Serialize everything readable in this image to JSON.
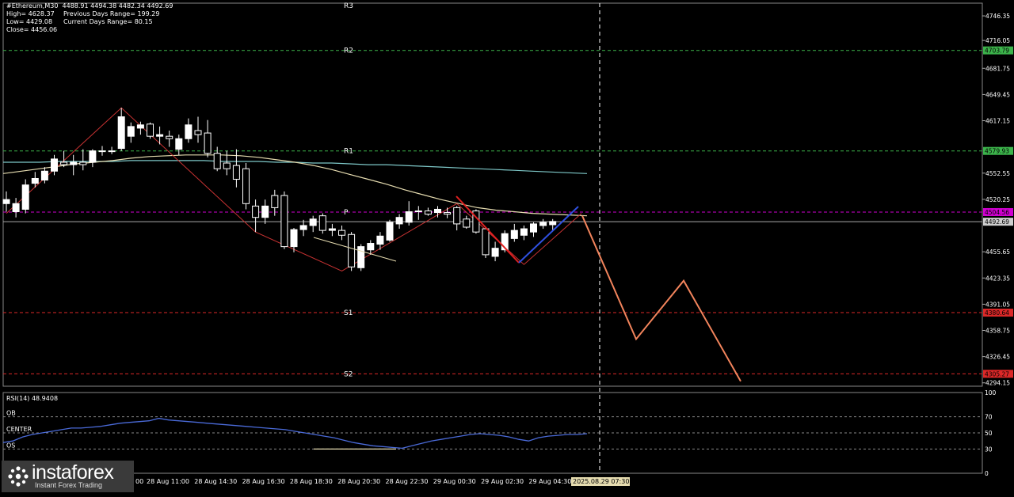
{
  "header": {
    "title": "#Ethereum,M30",
    "ohlc": "4488.91 4494.38 4482.34 4492.69",
    "high": "High= 4628.37",
    "prev_range": "Previous Days Range= 199.29",
    "low": "Low= 4429.08",
    "curr_range": "Current Days Range= 80.15",
    "close": "Close= 4456.06"
  },
  "watermark": {
    "brand": "instaforex",
    "tagline": "Instant Forex Trading"
  },
  "colors": {
    "background": "#000000",
    "bull_candle": "#ffffff",
    "bear_candle": "#000000",
    "ma_fast": "#c8e6a0",
    "ma_mid": "#e6dcb0",
    "ma_slow": "#7ec8c8",
    "zigzag": "#c83232",
    "forecast": "#f2845c",
    "rsi": "#4a6ad8",
    "pivot_green": "#3cb44b",
    "pivot_red": "#dc2828",
    "pivot_magenta": "#d000d0"
  },
  "price_axis": {
    "ticks": [
      "4746.35",
      "4716.05",
      "4681.75",
      "4649.45",
      "4617.15",
      "4552.55",
      "4520.25",
      "4455.65",
      "4423.35",
      "4391.05",
      "4358.75",
      "4326.45",
      "4294.15"
    ],
    "min": 4290,
    "max": 4762
  },
  "levels": [
    {
      "name": "R3",
      "label": "R3",
      "price": 4762,
      "box": "",
      "color": "#ffffff"
    },
    {
      "name": "R2",
      "label": "R2",
      "price": 4703.79,
      "box": "4703.79",
      "color": "#3cb44b"
    },
    {
      "name": "R1",
      "label": "R1",
      "price": 4579.93,
      "box": "4579.93",
      "color": "#3cb44b"
    },
    {
      "name": "P",
      "label": "P",
      "price": 4504.56,
      "box": "4504.56",
      "color": "#d000d0"
    },
    {
      "name": "S1",
      "label": "S1",
      "price": 4380.64,
      "box": "4380.64",
      "color": "#dc2828"
    },
    {
      "name": "S2",
      "label": "S2",
      "price": 4305.27,
      "box": "4305.27",
      "color": "#dc2828"
    }
  ],
  "current_price": {
    "price": 4492.69,
    "box": "4492.69"
  },
  "time_axis": {
    "labels": [
      "28 Aug 11:00",
      "28 Aug 14:30",
      "28 Aug 16:30",
      "28 Aug 18:30",
      "28 Aug 20:30",
      "28 Aug 22:30",
      "29 Aug 00:30",
      "29 Aug 02:30",
      "29 Aug 04:30"
    ],
    "highlight": "2025.08.29 07:30",
    "partial_first": "00"
  },
  "chart_data": {
    "type": "candlestick",
    "instrument": "#Ethereum",
    "timeframe": "M30",
    "candles": [
      {
        "o": 4515,
        "h": 4530,
        "l": 4505,
        "c": 4520
      },
      {
        "o": 4505,
        "h": 4522,
        "l": 4498,
        "c": 4515
      },
      {
        "o": 4508,
        "h": 4545,
        "l": 4503,
        "c": 4538
      },
      {
        "o": 4540,
        "h": 4554,
        "l": 4535,
        "c": 4546
      },
      {
        "o": 4544,
        "h": 4560,
        "l": 4540,
        "c": 4555
      },
      {
        "o": 4555,
        "h": 4575,
        "l": 4550,
        "c": 4570
      },
      {
        "o": 4566,
        "h": 4580,
        "l": 4560,
        "c": 4563
      },
      {
        "o": 4563,
        "h": 4575,
        "l": 4550,
        "c": 4566
      },
      {
        "o": 4566,
        "h": 4582,
        "l": 4556,
        "c": 4563
      },
      {
        "o": 4566,
        "h": 4582,
        "l": 4560,
        "c": 4580
      },
      {
        "o": 4580,
        "h": 4586,
        "l": 4574,
        "c": 4580
      },
      {
        "o": 4580,
        "h": 4585,
        "l": 4576,
        "c": 4580
      },
      {
        "o": 4583,
        "h": 4633,
        "l": 4580,
        "c": 4622
      },
      {
        "o": 4598,
        "h": 4615,
        "l": 4590,
        "c": 4610
      },
      {
        "o": 4608,
        "h": 4616,
        "l": 4600,
        "c": 4612
      },
      {
        "o": 4613,
        "h": 4615,
        "l": 4595,
        "c": 4598
      },
      {
        "o": 4598,
        "h": 4610,
        "l": 4588,
        "c": 4600
      },
      {
        "o": 4598,
        "h": 4605,
        "l": 4585,
        "c": 4595
      },
      {
        "o": 4582,
        "h": 4600,
        "l": 4575,
        "c": 4595
      },
      {
        "o": 4595,
        "h": 4620,
        "l": 4590,
        "c": 4612
      },
      {
        "o": 4605,
        "h": 4622,
        "l": 4590,
        "c": 4600
      },
      {
        "o": 4602,
        "h": 4618,
        "l": 4572,
        "c": 4577
      },
      {
        "o": 4577,
        "h": 4585,
        "l": 4555,
        "c": 4558
      },
      {
        "o": 4565,
        "h": 4580,
        "l": 4550,
        "c": 4558
      },
      {
        "o": 4562,
        "h": 4582,
        "l": 4535,
        "c": 4545
      },
      {
        "o": 4558,
        "h": 4565,
        "l": 4508,
        "c": 4515
      },
      {
        "o": 4512,
        "h": 4520,
        "l": 4480,
        "c": 4498
      },
      {
        "o": 4498,
        "h": 4520,
        "l": 4490,
        "c": 4512
      },
      {
        "o": 4525,
        "h": 4532,
        "l": 4500,
        "c": 4510
      },
      {
        "o": 4525,
        "h": 4530,
        "l": 4459,
        "c": 4462
      },
      {
        "o": 4462,
        "h": 4485,
        "l": 4455,
        "c": 4483
      },
      {
        "o": 4483,
        "h": 4495,
        "l": 4475,
        "c": 4488
      },
      {
        "o": 4488,
        "h": 4500,
        "l": 4480,
        "c": 4496
      },
      {
        "o": 4500,
        "h": 4503,
        "l": 4478,
        "c": 4482
      },
      {
        "o": 4482,
        "h": 4490,
        "l": 4475,
        "c": 4484
      },
      {
        "o": 4482,
        "h": 4488,
        "l": 4470,
        "c": 4476
      },
      {
        "o": 4477,
        "h": 4480,
        "l": 4432,
        "c": 4437
      },
      {
        "o": 4436,
        "h": 4465,
        "l": 4432,
        "c": 4462
      },
      {
        "o": 4458,
        "h": 4470,
        "l": 4452,
        "c": 4466
      },
      {
        "o": 4465,
        "h": 4480,
        "l": 4458,
        "c": 4475
      },
      {
        "o": 4470,
        "h": 4495,
        "l": 4468,
        "c": 4492
      },
      {
        "o": 4490,
        "h": 4502,
        "l": 4484,
        "c": 4498
      },
      {
        "o": 4492,
        "h": 4518,
        "l": 4488,
        "c": 4505
      },
      {
        "o": 4506,
        "h": 4512,
        "l": 4495,
        "c": 4506
      },
      {
        "o": 4506,
        "h": 4510,
        "l": 4500,
        "c": 4502
      },
      {
        "o": 4504,
        "h": 4512,
        "l": 4498,
        "c": 4508
      },
      {
        "o": 4504,
        "h": 4510,
        "l": 4497,
        "c": 4502
      },
      {
        "o": 4510,
        "h": 4512,
        "l": 4482,
        "c": 4490
      },
      {
        "o": 4496,
        "h": 4500,
        "l": 4484,
        "c": 4486
      },
      {
        "o": 4506,
        "h": 4508,
        "l": 4478,
        "c": 4480
      },
      {
        "o": 4484,
        "h": 4486,
        "l": 4448,
        "c": 4452
      },
      {
        "o": 4450,
        "h": 4468,
        "l": 4444,
        "c": 4460
      },
      {
        "o": 4458,
        "h": 4482,
        "l": 4455,
        "c": 4478
      },
      {
        "o": 4472,
        "h": 4490,
        "l": 4468,
        "c": 4482
      },
      {
        "o": 4476,
        "h": 4488,
        "l": 4470,
        "c": 4484
      },
      {
        "o": 4480,
        "h": 4492,
        "l": 4474,
        "c": 4490
      },
      {
        "o": 4488,
        "h": 4496,
        "l": 4484,
        "c": 4492
      },
      {
        "o": 4489,
        "h": 4496,
        "l": 4482,
        "c": 4493
      }
    ],
    "ma_fast": [
      4552,
      4555,
      4558,
      4561,
      4564,
      4566,
      4568,
      4571,
      4573,
      4574,
      4575,
      4575,
      4575,
      4574,
      4572,
      4569,
      4566,
      4562,
      4557,
      4551,
      4545,
      4539,
      4532,
      4526,
      4520,
      4515,
      4510,
      4507,
      4505,
      4503,
      4502,
      4501,
      4500
    ],
    "ma_slow": [
      4566,
      4566,
      4566,
      4567,
      4567,
      4567,
      4567,
      4568,
      4568,
      4568,
      4568,
      4568,
      4567,
      4567,
      4567,
      4566,
      4566,
      4565,
      4565,
      4564,
      4563,
      4563,
      4562,
      4561,
      4560,
      4559,
      4558,
      4557,
      4556,
      4555,
      4554,
      4553,
      4552
    ],
    "zigzag": [
      {
        "i": 0,
        "p": 4503
      },
      {
        "i": 12,
        "p": 4633
      },
      {
        "i": 26,
        "p": 4480
      },
      {
        "i": 35,
        "p": 4432
      },
      {
        "i": 47,
        "p": 4515
      },
      {
        "i": 54,
        "p": 4440
      },
      {
        "i": 60,
        "p": 4503
      }
    ],
    "forecast": [
      {
        "x": 735,
        "p": 4500
      },
      {
        "x": 803,
        "p": 4348
      },
      {
        "x": 863,
        "p": 4420
      },
      {
        "x": 935,
        "p": 4296
      }
    ],
    "rsi": {
      "label": "RSI(14) 48.9408",
      "period": 14,
      "current": 48.9408,
      "values": [
        38,
        40,
        45,
        48,
        50,
        52,
        54,
        56,
        56,
        57,
        58,
        60,
        62,
        63,
        64,
        65,
        68,
        66,
        65,
        64,
        63,
        62,
        61,
        60,
        59,
        58,
        57,
        56,
        55,
        54,
        52,
        50,
        48,
        46,
        44,
        41,
        38,
        36,
        34,
        33,
        32,
        31,
        34,
        37,
        40,
        42,
        44,
        46,
        48,
        49,
        48,
        47,
        45,
        42,
        40,
        44,
        46,
        47,
        48,
        48,
        49
      ],
      "levels": [
        {
          "label": "OB",
          "value": 70
        },
        {
          "label": "CENTER",
          "value": 50
        },
        {
          "label": "OS",
          "value": 30
        }
      ],
      "axis_ticks": [
        "100",
        "70",
        "50",
        "30",
        "0"
      ],
      "ylim": [
        0,
        100
      ]
    }
  }
}
